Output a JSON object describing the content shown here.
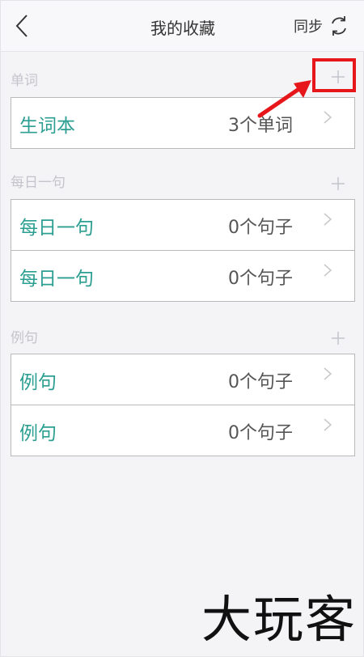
{
  "header": {
    "title": "我的收藏",
    "sync_label": "同步",
    "back_icon": "chevron-left-icon",
    "sync_icon": "refresh-icon"
  },
  "sections": [
    {
      "title": "单词",
      "rows": [
        {
          "label": "生词本",
          "count": "3个单词"
        }
      ]
    },
    {
      "title": "每日一句",
      "rows": [
        {
          "label": "每日一句",
          "count": "0个句子"
        },
        {
          "label": "每日一句",
          "count": "0个句子"
        }
      ]
    },
    {
      "title": "例句",
      "rows": [
        {
          "label": "例句",
          "count": "0个句子"
        },
        {
          "label": "例句",
          "count": "0个句子"
        }
      ]
    }
  ],
  "annotation": {
    "highlight_color": "#e6161b"
  },
  "watermark": "大玩客",
  "colors": {
    "accent": "#2c9f92",
    "section_title": "#c4c4cc",
    "background": "#f4f4f7"
  }
}
